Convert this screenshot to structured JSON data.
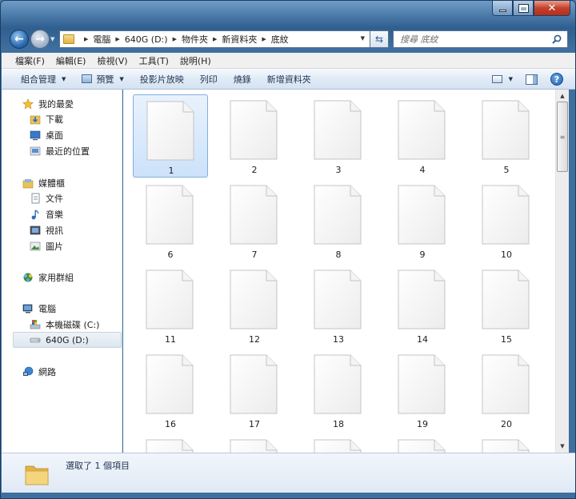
{
  "address": {
    "crumbs": [
      "電腦",
      "640G (D:)",
      "物件夾",
      "新資料夾",
      "底紋"
    ]
  },
  "search": {
    "placeholder": "搜尋 底紋"
  },
  "menu": [
    "檔案(F)",
    "編輯(E)",
    "檢視(V)",
    "工具(T)",
    "說明(H)"
  ],
  "toolbar": {
    "organize": "組合管理",
    "preview": "預覽",
    "slideshow": "投影片放映",
    "print": "列印",
    "burn": "燒錄",
    "new_folder": "新增資料夾"
  },
  "navpane": {
    "favorites": {
      "label": "我的最愛",
      "items": [
        "下載",
        "桌面",
        "最近的位置"
      ]
    },
    "libraries": {
      "label": "媒體櫃",
      "items": [
        "文件",
        "音樂",
        "視訊",
        "圖片"
      ]
    },
    "homegroup": {
      "label": "家用群組"
    },
    "computer": {
      "label": "電腦",
      "items": [
        "本機磁碟 (C:)",
        "640G (D:)"
      ],
      "selected": "640G (D:)"
    },
    "network": {
      "label": "網路"
    }
  },
  "files": [
    "1",
    "2",
    "3",
    "4",
    "5",
    "6",
    "7",
    "8",
    "9",
    "10",
    "11",
    "12",
    "13",
    "14",
    "15",
    "16",
    "17",
    "18",
    "19",
    "20",
    "",
    "",
    "",
    "",
    ""
  ],
  "selected_file": "1",
  "status": {
    "text": "選取了 1 個項目"
  }
}
